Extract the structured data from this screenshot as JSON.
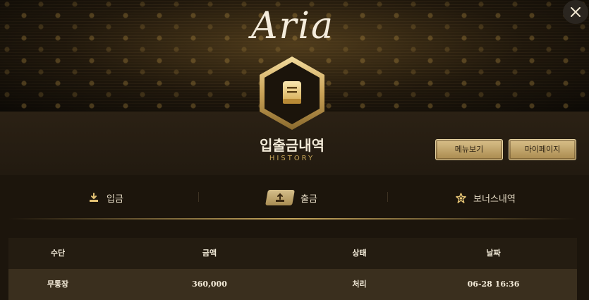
{
  "brand": {
    "logo_text": "Aria"
  },
  "header": {
    "title": "입출금내역",
    "subtitle": "HISTORY",
    "buttons": {
      "menu": "메뉴보기",
      "mypage": "마이페이지"
    }
  },
  "tabs": [
    {
      "label": "입금",
      "icon": "download-icon",
      "active": false
    },
    {
      "label": "출금",
      "icon": "upload-icon",
      "active": true
    },
    {
      "label": "보너스내역",
      "icon": "star-icon",
      "active": false
    }
  ],
  "table": {
    "columns": [
      "수단",
      "금액",
      "상태",
      "날짜"
    ],
    "rows": [
      [
        "무통장",
        "360,000",
        "처리",
        "06-28 16:36"
      ]
    ]
  },
  "colors": {
    "accent_gold": "#c9a85e",
    "button_gold": "#d9c08a",
    "background": "#1c150c"
  }
}
